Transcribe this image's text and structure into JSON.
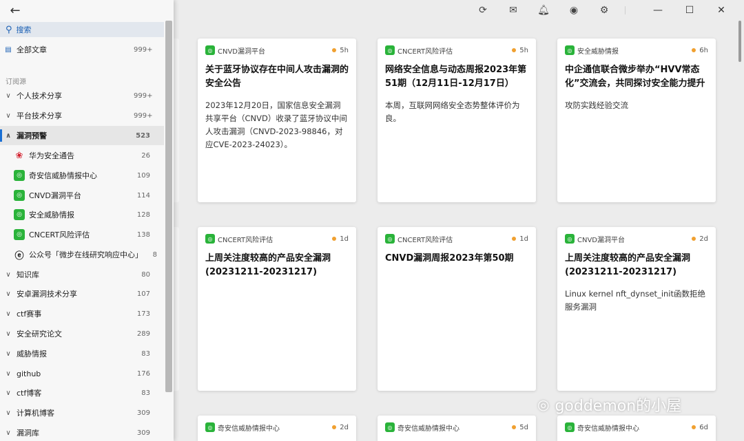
{
  "sidebar": {
    "search_label": "搜索",
    "all_articles": {
      "label": "全部文章",
      "count": "999+"
    },
    "section_title": "订阅源",
    "groups": [
      {
        "label": "个人技术分享",
        "count": "999+",
        "expanded": false
      },
      {
        "label": "平台技术分享",
        "count": "999+",
        "expanded": false
      },
      {
        "label": "漏洞预警",
        "count": "523",
        "expanded": true
      }
    ],
    "feeds": [
      {
        "label": "华为安全通告",
        "count": "26",
        "icon": "huawei-logo"
      },
      {
        "label": "奇安信威胁情报中心",
        "count": "109",
        "icon": "wechat-icon"
      },
      {
        "label": "CNVD漏洞平台",
        "count": "114",
        "icon": "wechat-icon"
      },
      {
        "label": "安全威胁情报",
        "count": "128",
        "icon": "wechat-icon"
      },
      {
        "label": "CNCERT风险评估",
        "count": "138",
        "icon": "wechat-icon"
      },
      {
        "label": "公众号「微步在线研究响应中心」",
        "count": "8",
        "icon": "threatbook-logo"
      }
    ],
    "more_groups": [
      {
        "label": "知识库",
        "count": "80"
      },
      {
        "label": "安卓漏洞技术分享",
        "count": "107"
      },
      {
        "label": "ctf赛事",
        "count": "173"
      },
      {
        "label": "安全研究论文",
        "count": "289"
      },
      {
        "label": "威胁情报",
        "count": "83"
      },
      {
        "label": "github",
        "count": "176"
      },
      {
        "label": "ctf博客",
        "count": "83"
      },
      {
        "label": "计算机博客",
        "count": "309"
      },
      {
        "label": "漏洞库",
        "count": "309"
      }
    ]
  },
  "cards": [
    {
      "source": "CNVD漏洞平台",
      "time": "5h",
      "title": "关于蓝牙协议存在中间人攻击漏洞的安全公告",
      "desc": "2023年12月20日，国家信息安全漏洞共享平台（CNVD）收录了蓝牙协议中间人攻击漏洞（CNVD-2023-98846，对应CVE-2023-24023）。"
    },
    {
      "source": "CNCERT风险评估",
      "time": "5h",
      "title": "网络安全信息与动态周报2023年第51期（12月11日-12月17日）",
      "desc": "本周，互联网网络安全态势整体评价为良。"
    },
    {
      "source": "安全威胁情报",
      "time": "6h",
      "title": "中企通信联合微步举办“HVV常态化”交流会，共同探讨安全能力提升",
      "desc": "攻防实践经验交流"
    },
    {
      "source": "CNCERT风险评估",
      "time": "1d",
      "title": "上周关注度较高的产品安全漏洞(20231211-20231217)",
      "desc": ""
    },
    {
      "source": "CNCERT风险评估",
      "time": "1d",
      "title": "CNVD漏洞周报2023年第50期",
      "desc": ""
    },
    {
      "source": "CNVD漏洞平台",
      "time": "2d",
      "title": "上周关注度较高的产品安全漏洞(20231211-20231217)",
      "desc": "Linux kernel nft_dynset_init函数拒绝服务漏洞"
    },
    {
      "source": "奇安信威胁情报中心",
      "time": "2d",
      "title": "",
      "desc": ""
    },
    {
      "source": "奇安信威胁情报中心",
      "time": "5d",
      "title": "",
      "desc": ""
    },
    {
      "source": "奇安信威胁情报中心",
      "time": "6d",
      "title": "",
      "desc": ""
    }
  ],
  "watermark": "goddemon的小屋"
}
